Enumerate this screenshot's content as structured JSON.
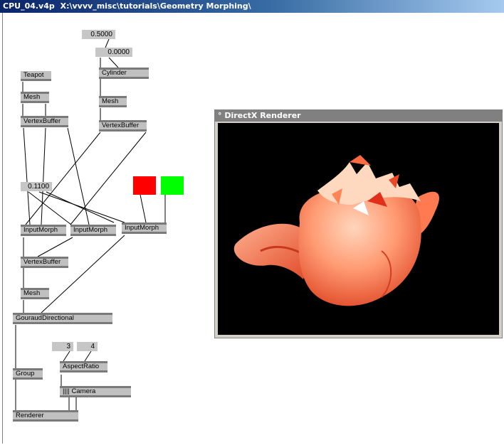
{
  "window": {
    "title": "CPU_04.v4p",
    "path": "X:\\vvvv_misc\\tutorials\\Geometry Morphing\\"
  },
  "io_boxes": {
    "val_top": "0.5000",
    "val_second": "0.0000",
    "val_blend": "0.1100",
    "val_aspect_x": "3",
    "val_aspect_y": "4"
  },
  "nodes": {
    "teapot": "Teapot",
    "mesh_teapot": "Mesh",
    "vertexbuffer_teapot": "VertexBuffer",
    "cylinder": "Cylinder",
    "mesh_cylinder": "Mesh",
    "vertexbuffer_cylinder": "VertexBuffer",
    "inputmorph_1": "InputMorph",
    "inputmorph_2": "InputMorph",
    "inputmorph_3": "InputMorph",
    "vertexbuffer_out": "VertexBuffer",
    "mesh_out": "Mesh",
    "gouraud": "GouraudDirectional",
    "aspectratio": "AspectRatio",
    "camera": "|||| Camera",
    "group": "Group",
    "renderer": "Renderer"
  },
  "colors": {
    "red": "#ff0000",
    "green": "#00ff00",
    "teapot_light": "#ffd6bd",
    "teapot_mid": "#ff9068",
    "teapot_dark": "#e03a1c"
  },
  "render_window": {
    "title": "° DirectX Renderer"
  }
}
